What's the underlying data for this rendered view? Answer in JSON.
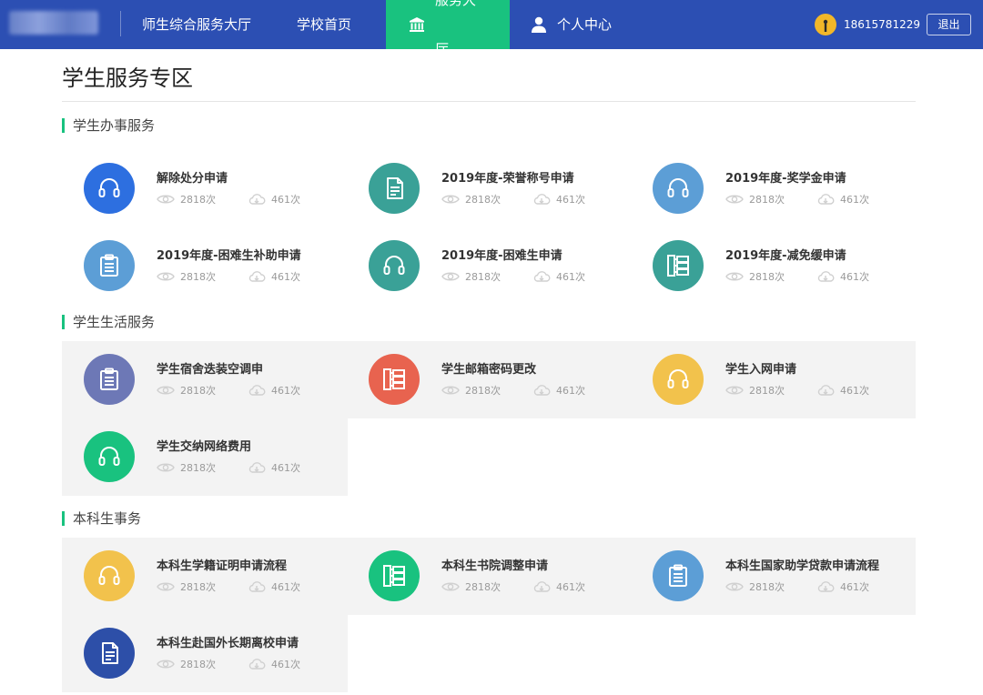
{
  "header": {
    "portal_title": "师生综合服务大厅",
    "nav": [
      {
        "label": "学校首页",
        "active": false
      },
      {
        "label": "服务大厅",
        "active": true
      },
      {
        "label": "个人中心",
        "active": false
      }
    ],
    "user_phone": "18615781229",
    "logout_label": "退出",
    "accent": "#19c27f",
    "bar_color": "#2c4fb3"
  },
  "page": {
    "title": "学生服务专区"
  },
  "sections": [
    {
      "title": "学生办事服务",
      "items": [
        {
          "title": "解除处分申请",
          "icon": "headset-icon",
          "color": "#2d6fe0",
          "views": "2818次",
          "downloads": "461次"
        },
        {
          "title": "2019年度-荣誉称号申请",
          "icon": "document-icon",
          "color": "#3aa197",
          "views": "2818次",
          "downloads": "461次"
        },
        {
          "title": "2019年度-奖学金申请",
          "icon": "headset-icon",
          "color": "#5c9ed6",
          "views": "2818次",
          "downloads": "461次"
        },
        {
          "title": "2019年度-困难生补助申请",
          "icon": "clipboard-icon",
          "color": "#5c9ed6",
          "views": "2818次",
          "downloads": "461次"
        },
        {
          "title": "2019年度-困难生申请",
          "icon": "headset-icon",
          "color": "#3aa197",
          "views": "2818次",
          "downloads": "461次"
        },
        {
          "title": "2019年度-减免缓申请",
          "icon": "tree-icon",
          "color": "#3aa197",
          "views": "2818次",
          "downloads": "461次"
        }
      ]
    },
    {
      "title": "学生生活服务",
      "items": [
        {
          "title": "学生宿舍迭装空调申",
          "icon": "clipboard-icon",
          "color": "#6d78b6",
          "views": "2818次",
          "downloads": "461次"
        },
        {
          "title": "学生邮箱密码更改",
          "icon": "tree-icon",
          "color": "#e8634f",
          "views": "2818次",
          "downloads": "461次"
        },
        {
          "title": "学生入网申请",
          "icon": "headset-icon",
          "color": "#f2c24c",
          "views": "2818次",
          "downloads": "461次"
        },
        {
          "title": "学生交纳网络费用",
          "icon": "headset-icon",
          "color": "#19c27f",
          "views": "2818次",
          "downloads": "461次"
        }
      ]
    },
    {
      "title": "本科生事务",
      "items": [
        {
          "title": "本科生学籍证明申请流程",
          "icon": "headset-icon",
          "color": "#f2c24c",
          "views": "2818次",
          "downloads": "461次"
        },
        {
          "title": "本科生书院调整申请",
          "icon": "tree-icon",
          "color": "#19c27f",
          "views": "2818次",
          "downloads": "461次"
        },
        {
          "title": "本科生国家助学贷款申请流程",
          "icon": "clipboard-icon",
          "color": "#5c9ed6",
          "views": "2818次",
          "downloads": "461次"
        },
        {
          "title": "本科生赴国外长期离校申请",
          "icon": "document-icon",
          "color": "#2d4fa8",
          "views": "2818次",
          "downloads": "461次"
        }
      ]
    }
  ]
}
